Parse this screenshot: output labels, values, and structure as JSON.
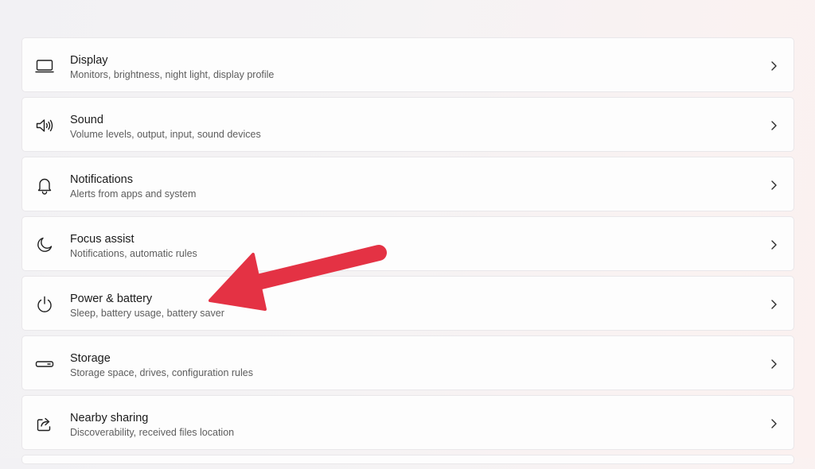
{
  "settings": {
    "items": [
      {
        "id": "display",
        "icon": "display-icon",
        "title": "Display",
        "subtitle": "Monitors, brightness, night light, display profile"
      },
      {
        "id": "sound",
        "icon": "speaker-icon",
        "title": "Sound",
        "subtitle": "Volume levels, output, input, sound devices"
      },
      {
        "id": "notifications",
        "icon": "bell-icon",
        "title": "Notifications",
        "subtitle": "Alerts from apps and system"
      },
      {
        "id": "focus-assist",
        "icon": "moon-icon",
        "title": "Focus assist",
        "subtitle": "Notifications, automatic rules"
      },
      {
        "id": "power-battery",
        "icon": "power-icon",
        "title": "Power & battery",
        "subtitle": "Sleep, battery usage, battery saver"
      },
      {
        "id": "storage",
        "icon": "storage-drive-icon",
        "title": "Storage",
        "subtitle": "Storage space, drives, configuration rules"
      },
      {
        "id": "nearby-sharing",
        "icon": "share-icon",
        "title": "Nearby sharing",
        "subtitle": "Discoverability, received files location"
      }
    ]
  },
  "annotation": {
    "arrow_color": "#e43244",
    "points_to": "power-battery"
  }
}
